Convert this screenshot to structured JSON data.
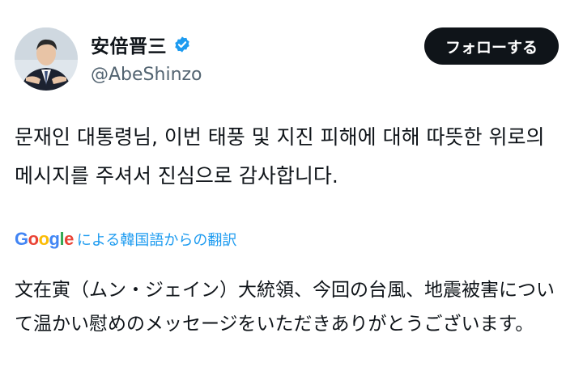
{
  "author": {
    "display_name": "安倍晋三",
    "handle": "@AbeShinzo",
    "verified": true,
    "verified_color": "#1d9bf0"
  },
  "follow_button": {
    "label": "フォローする"
  },
  "tweet": {
    "text": "문재인 대통령님, 이번 태풍 및 지진 피해에 대해 따뜻한 위로의 메시지를 주셔서 진심으로 감사합니다."
  },
  "translation": {
    "provider_logo": "Google",
    "label": "による韓国語からの翻訳",
    "text": "文在寅（ムン・ジェイン）大統領、今回の台風、地震被害について温かい慰めのメッセージをいただきありがとうございます。"
  },
  "colors": {
    "link_blue": "#1d9bf0",
    "text_primary": "#0f1419",
    "text_secondary": "#536471"
  }
}
